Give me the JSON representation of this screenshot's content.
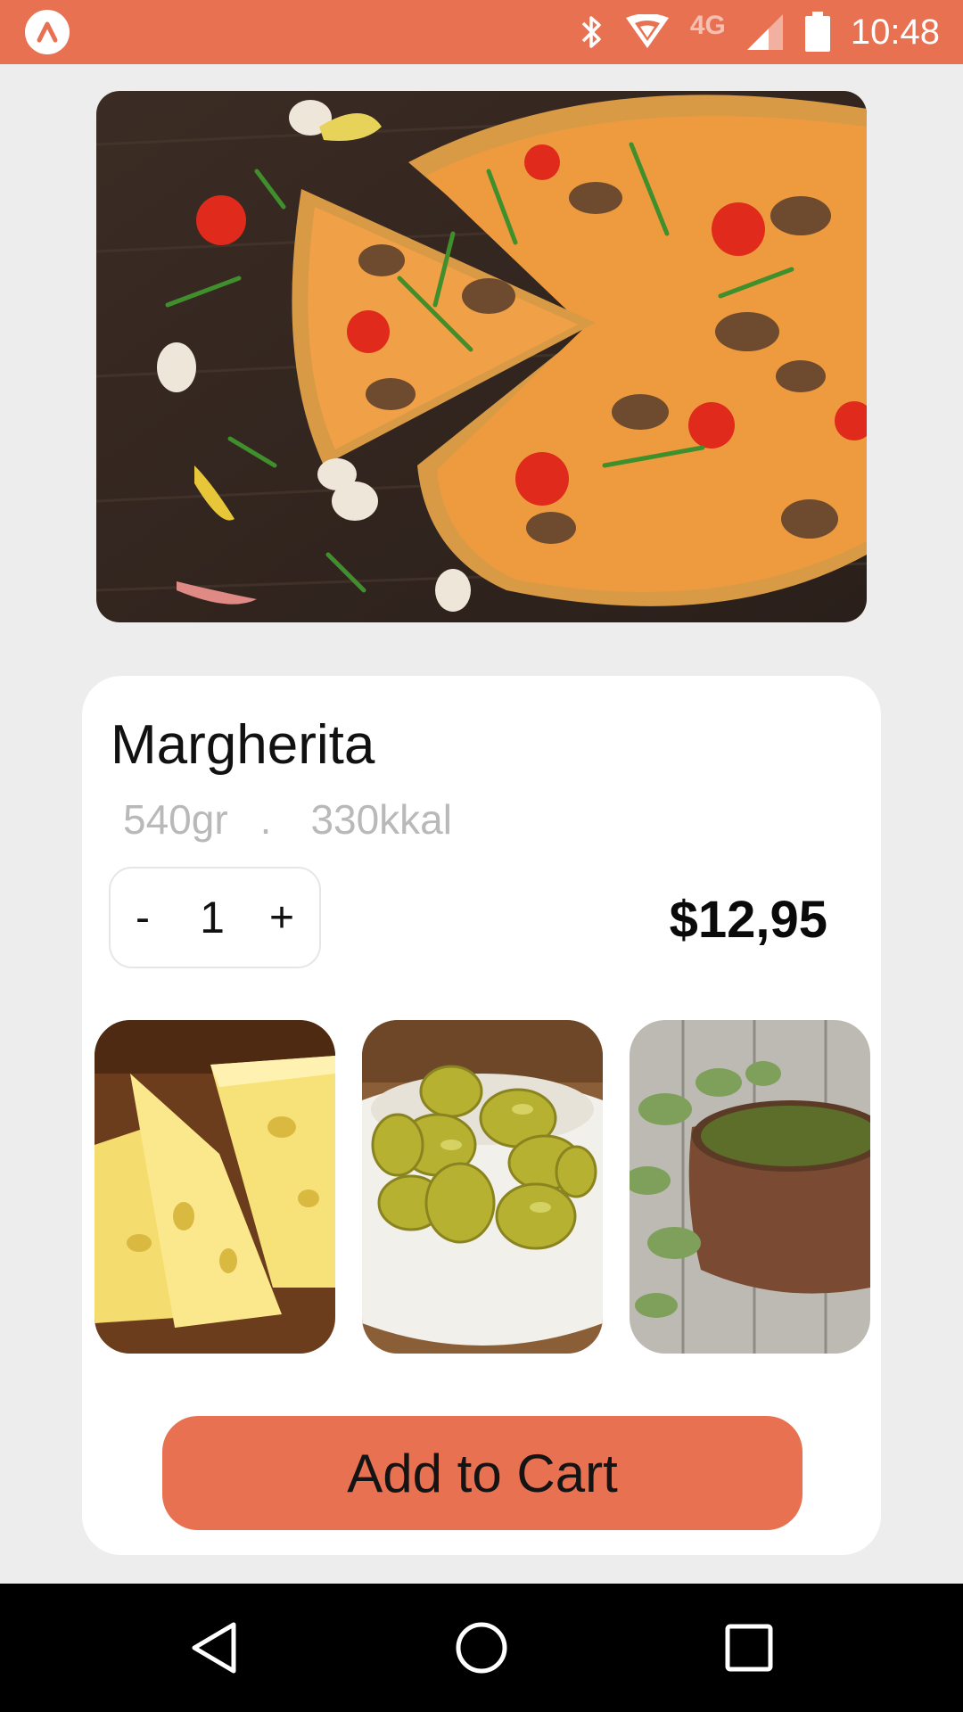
{
  "status_bar": {
    "network_type": "4G",
    "time": "10:48",
    "icons": [
      "app-logo-icon",
      "bluetooth-icon",
      "wifi-icon",
      "signal-icon",
      "battery-icon"
    ],
    "background_color": "#e87152"
  },
  "hero": {
    "image_subject": "pizza"
  },
  "product": {
    "name": "Margherita",
    "weight": "540gr",
    "separator": ".",
    "calories": "330kkal",
    "price": "$12,95"
  },
  "stepper": {
    "minus_label": "-",
    "quantity": "1",
    "plus_label": "+"
  },
  "ingredients": [
    {
      "subject": "cheese"
    },
    {
      "subject": "olives"
    },
    {
      "subject": "oregano"
    }
  ],
  "cart_button": {
    "label": "Add to Cart",
    "color": "#e87152"
  },
  "nav_bar": {
    "icons": [
      "back-icon",
      "home-icon",
      "recents-icon"
    ]
  }
}
